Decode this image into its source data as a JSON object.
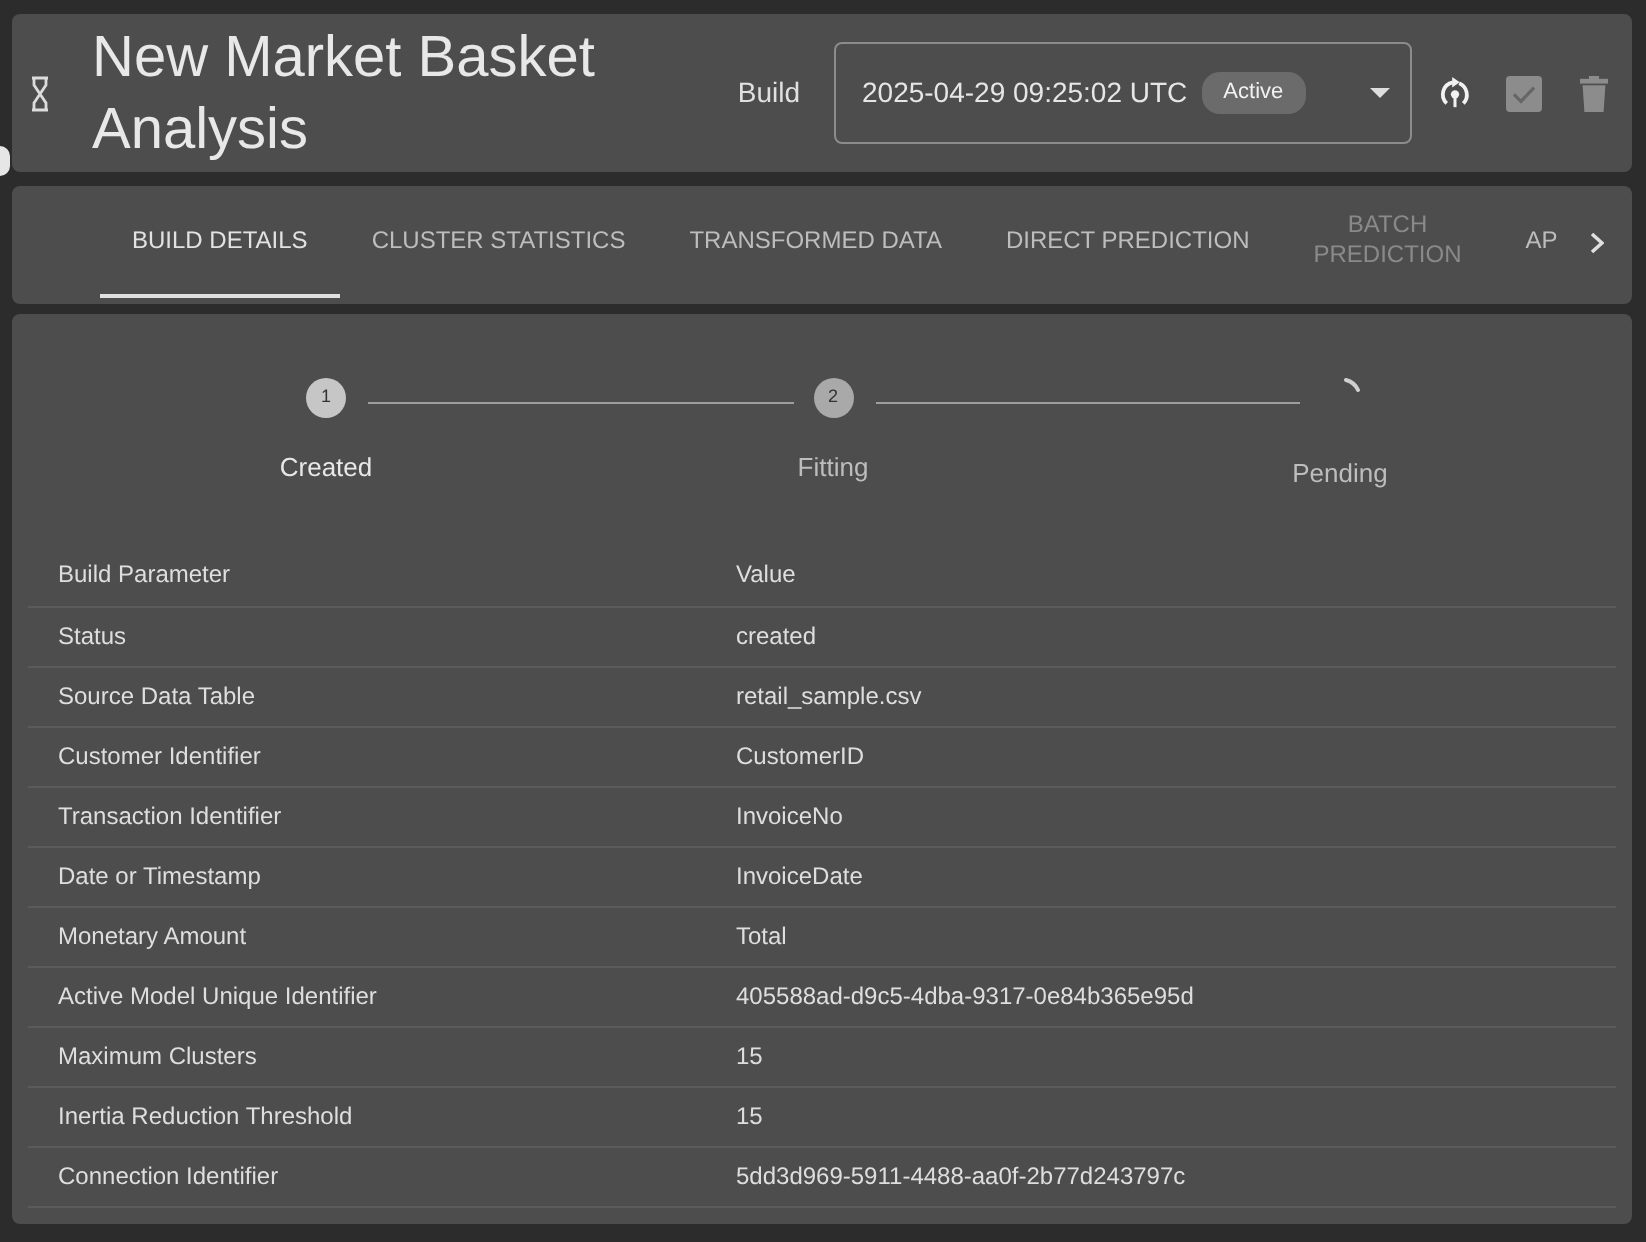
{
  "header": {
    "title": "New Market Basket Analysis",
    "build_label": "Build",
    "build_select": {
      "value": "2025-04-29 09:25:02 UTC",
      "badge": "Active"
    },
    "actions": [
      {
        "kind": "sync",
        "disabled": false
      },
      {
        "kind": "approve",
        "disabled": true
      },
      {
        "kind": "delete",
        "disabled": true
      }
    ]
  },
  "tabs": [
    {
      "label": "BUILD DETAILS",
      "selected": true,
      "disabled": false
    },
    {
      "label": "CLUSTER STATISTICS",
      "selected": false,
      "disabled": false
    },
    {
      "label": "TRANSFORMED DATA",
      "selected": false,
      "disabled": false
    },
    {
      "label": "DIRECT PREDICTION",
      "selected": false,
      "disabled": false
    },
    {
      "label": "BATCH PREDICTION",
      "selected": false,
      "disabled": true,
      "wrap": true
    },
    {
      "label": "AP",
      "selected": false,
      "disabled": false
    }
  ],
  "steps": [
    {
      "kind": "number",
      "number": "1",
      "label": "Created",
      "active": true
    },
    {
      "kind": "number",
      "number": "2",
      "label": "Fitting",
      "active": false
    },
    {
      "kind": "spinner",
      "label": "Pending",
      "active": false
    }
  ],
  "table": {
    "columns": [
      "Build Parameter",
      "Value"
    ],
    "rows": [
      [
        "Status",
        "created"
      ],
      [
        "Source Data Table",
        "retail_sample.csv"
      ],
      [
        "Customer Identifier",
        "CustomerID"
      ],
      [
        "Transaction Identifier",
        "InvoiceNo"
      ],
      [
        "Date or Timestamp",
        "InvoiceDate"
      ],
      [
        "Monetary Amount",
        "Total"
      ],
      [
        "Active Model Unique Identifier",
        "405588ad-d9c5-4dba-9317-0e84b365e95d"
      ],
      [
        "Maximum Clusters",
        "15"
      ],
      [
        "Inertia Reduction Threshold",
        "15"
      ],
      [
        "Connection Identifier",
        "5dd3d969-5911-4488-aa0f-2b77d243797c"
      ]
    ]
  }
}
